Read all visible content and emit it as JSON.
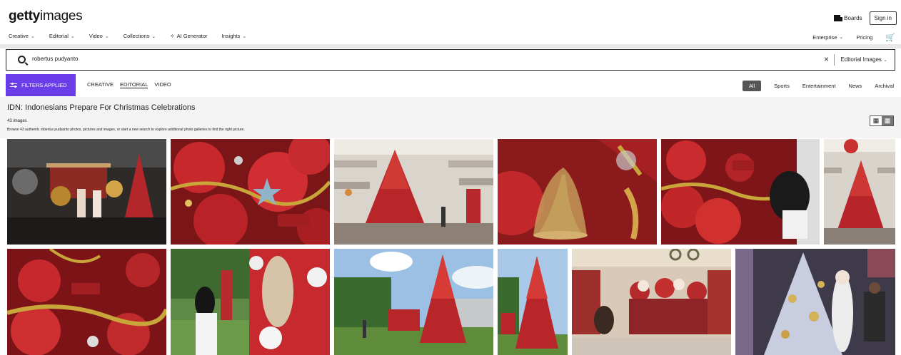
{
  "brand": {
    "logo_bold": "getty",
    "logo_light": "images"
  },
  "header": {
    "boards_label": "Boards",
    "signin_label": "Sign in",
    "nav": [
      "Creative",
      "Editorial",
      "Video",
      "Collections",
      "AI Generator",
      "Insights"
    ],
    "nav_right": {
      "enterprise": "Enterprise",
      "pricing": "Pricing"
    }
  },
  "search": {
    "value": "robertus pudyanto",
    "clear_label": "×",
    "select_value": "Editorial Images"
  },
  "filters": {
    "applied_label": "FILTERS APPLIED",
    "types": [
      "CREATIVE",
      "EDITORIAL",
      "VIDEO"
    ],
    "active_type": "EDITORIAL",
    "categories": [
      "All",
      "Sports",
      "Entertainment",
      "News",
      "Archival"
    ],
    "active_category": "All"
  },
  "results": {
    "title": "IDN: Indonesians Prepare For Christmas Celebrations",
    "count": "43 images",
    "description": "Browse 43 authentic robertus pudyanto photos, pictures and images, or start a new search to explore additional photo galleries to find the right picture."
  },
  "colors": {
    "accent": "#6a3de8",
    "red": "#c0262a",
    "dark": "#2a2a2a"
  },
  "images": [
    {
      "alt": "Women posing by Christmas decorations in dark hall",
      "scene": "hall-dark"
    },
    {
      "alt": "Red Christmas ornaments with Merry Christmas sign",
      "scene": "ornaments"
    },
    {
      "alt": "Red Christmas tree in mall atrium",
      "scene": "mall-tree"
    },
    {
      "alt": "Golden bell ornament close-up",
      "scene": "bell"
    },
    {
      "alt": "Woman arranging red lanterns",
      "scene": "lanterns"
    },
    {
      "alt": "Red Christmas tree in mall",
      "scene": "mall-tree"
    },
    {
      "alt": "Red lanterns with Merry Christmas sign",
      "scene": "lanterns"
    },
    {
      "alt": "Woman decorating red and white decoration outdoors",
      "scene": "outdoor-woman"
    },
    {
      "alt": "Red Christmas tree on lawn",
      "scene": "outdoor-tree"
    },
    {
      "alt": "Red Christmas tree outdoors",
      "scene": "outdoor-tree"
    },
    {
      "alt": "Santa figurines in shop",
      "scene": "shop-santa"
    },
    {
      "alt": "White and gold Christmas tree with Santa figure",
      "scene": "white-tree"
    }
  ]
}
